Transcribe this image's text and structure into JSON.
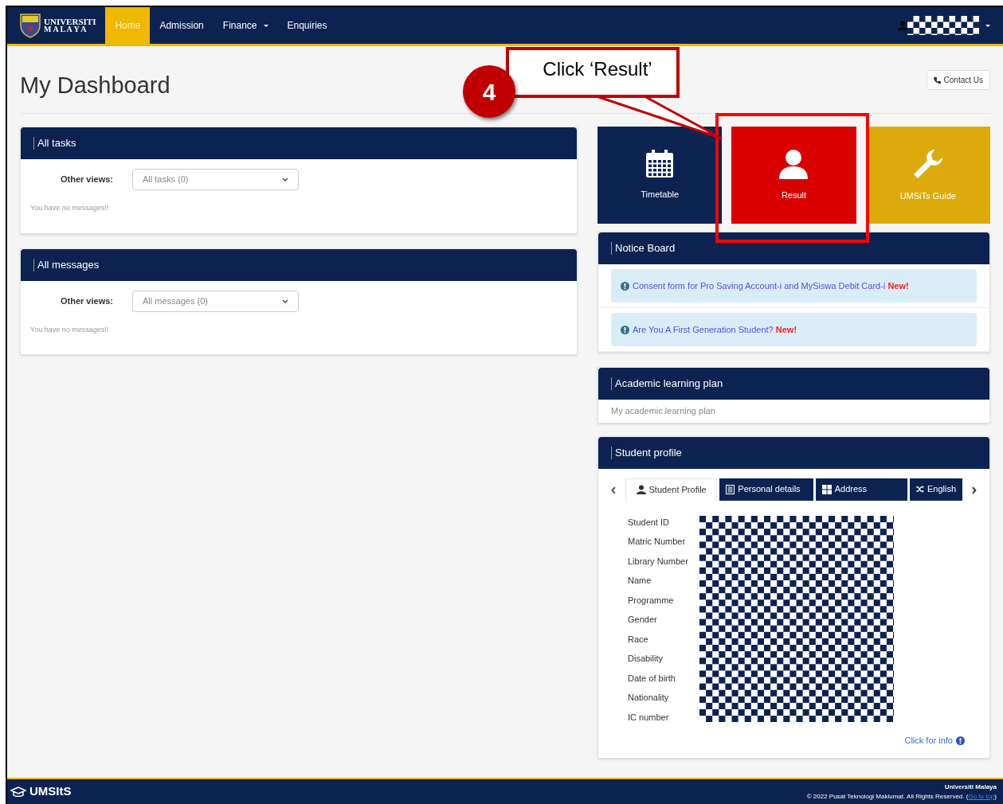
{
  "nav": {
    "brand_line1": "UNIVERSITI",
    "brand_line2": "M A L A Y A",
    "items": [
      {
        "label": "Home",
        "selected": true,
        "dropdown": false
      },
      {
        "label": "Admission",
        "selected": false,
        "dropdown": false
      },
      {
        "label": "Finance",
        "selected": false,
        "dropdown": true
      },
      {
        "label": "Enquiries",
        "selected": false,
        "dropdown": false
      }
    ]
  },
  "page": {
    "title": "My Dashboard",
    "contact_button": "Contact Us"
  },
  "left_panels": [
    {
      "title": "All tasks",
      "filter_label": "Other views:",
      "filter_value": "All tasks (0)",
      "message": "You have no messages!!"
    },
    {
      "title": "All messages",
      "filter_label": "Other views:",
      "filter_value": "All messages (0)",
      "message": "You have no messages!!"
    }
  ],
  "tiles": [
    {
      "label": "Timetable",
      "kind": "calendar",
      "color": "#0c2352",
      "highlighted": false
    },
    {
      "label": "Result",
      "kind": "person",
      "color": "#d90000",
      "highlighted": true
    },
    {
      "label": "UMSiTs Guide",
      "kind": "wrench",
      "color": "#dcab0b",
      "highlighted": false
    }
  ],
  "annotation": {
    "step": "4",
    "callout": "Click ‘Result’"
  },
  "notice_board": {
    "title": "Notice Board",
    "notices": [
      {
        "text": "Consent form for Pro Saving Account-i and MySiswa Debit Card-i",
        "badge": "New!"
      },
      {
        "text": "Are You A First Generation Student?",
        "badge": "New!"
      }
    ]
  },
  "learning_plan": {
    "title": "Academic learning plan",
    "text": "My academic learning plan"
  },
  "student_profile": {
    "title": "Student profile",
    "tabs": [
      {
        "label": "Student Profile",
        "kind": "user",
        "selected": true
      },
      {
        "label": "Personal details",
        "kind": "list",
        "selected": false
      },
      {
        "label": "Address",
        "kind": "grid",
        "selected": false
      },
      {
        "label": "English",
        "kind": "shuffle",
        "selected": false
      }
    ],
    "fields": [
      "Student ID",
      "Matric Number",
      "Library Number",
      "Name",
      "Programme",
      "Gender",
      "Race",
      "Disability",
      "Date of birth",
      "Nationality",
      "IC number"
    ],
    "info_link": "Click for info"
  },
  "footer": {
    "brand": "UMSItS",
    "org": "Universiti Malaya",
    "copyright": "© 2022 Pusat Teknologi Maklumat. All Rights Reserved. (",
    "top_link": "Go to top",
    "copyright_end": ")"
  }
}
